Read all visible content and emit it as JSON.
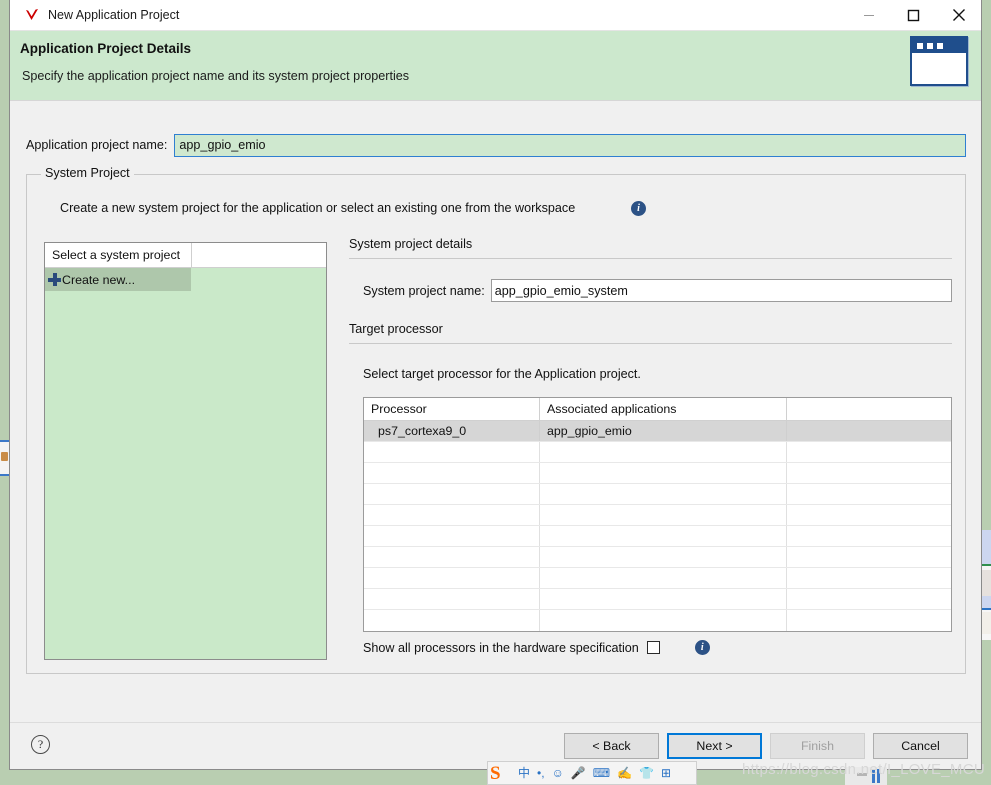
{
  "window": {
    "title": "New Application Project",
    "app_icon": "xilinx-sdk-icon",
    "minimize_label": "Minimize",
    "maximize_label": "Maximize",
    "close_label": "Close"
  },
  "banner": {
    "title": "Application Project Details",
    "subtitle": "Specify the application project name and its system project properties",
    "icon": "dialog-window-icon"
  },
  "form": {
    "project_name_label": "Application project name:",
    "project_name_value": "app_gpio_emio",
    "project_name_placeholder": "Application project name"
  },
  "system_project_group": {
    "legend": "System Project",
    "description": "Create a new system project for the application or select an existing one from the workspace",
    "info_icon": "info-icon",
    "list": {
      "header_label": "Select a system project",
      "items": [
        {
          "label": "Create new...",
          "icon": "plus-icon",
          "selected": true
        }
      ]
    },
    "details": {
      "section_title": "System project details",
      "name_label": "System project name:",
      "name_value": "app_gpio_emio_system",
      "name_placeholder": "System project name"
    },
    "target_processor": {
      "section_title": "Target processor",
      "instruction": "Select target processor for the Application project.",
      "columns": [
        "Processor",
        "Associated applications",
        ""
      ],
      "rows": [
        {
          "processor": "ps7_cortexa9_0",
          "associated": "app_gpio_emio",
          "extra": "",
          "selected": true
        },
        {
          "processor": "",
          "associated": "",
          "extra": "",
          "selected": false
        },
        {
          "processor": "",
          "associated": "",
          "extra": "",
          "selected": false
        },
        {
          "processor": "",
          "associated": "",
          "extra": "",
          "selected": false
        },
        {
          "processor": "",
          "associated": "",
          "extra": "",
          "selected": false
        },
        {
          "processor": "",
          "associated": "",
          "extra": "",
          "selected": false
        },
        {
          "processor": "",
          "associated": "",
          "extra": "",
          "selected": false
        },
        {
          "processor": "",
          "associated": "",
          "extra": "",
          "selected": false
        },
        {
          "processor": "",
          "associated": "",
          "extra": "",
          "selected": false
        },
        {
          "processor": "",
          "associated": "",
          "extra": "",
          "selected": false
        }
      ],
      "show_all_label": "Show all processors in the hardware specification",
      "show_all_checked": false,
      "show_all_info_icon": "info-icon"
    }
  },
  "footer": {
    "help_icon": "question-mark-icon",
    "back_label": "< Back",
    "next_label": "Next >",
    "finish_label": "Finish",
    "cancel_label": "Cancel"
  },
  "overlay": {
    "ime_logo": "S",
    "ime_icons": [
      "chinese-mode-icon",
      "punctuation-icon",
      "emoji-icon",
      "voice-input-icon",
      "keyboard-icon",
      "handwriting-icon",
      "skin-icon",
      "toolbox-icon"
    ],
    "watermark": "https://blog.csdn.net/I_LOVE_MCU"
  },
  "colors": {
    "banner_green": "#cce8cd",
    "input_green": "#cfe8cf",
    "list_green": "#cae9c9",
    "list_selected_green": "#aec7ab",
    "accent_blue": "#0078d7",
    "info_blue": "#2c5286",
    "row_selected_gray": "#d6d6d6",
    "desktop_green": "#b9ceb1"
  }
}
